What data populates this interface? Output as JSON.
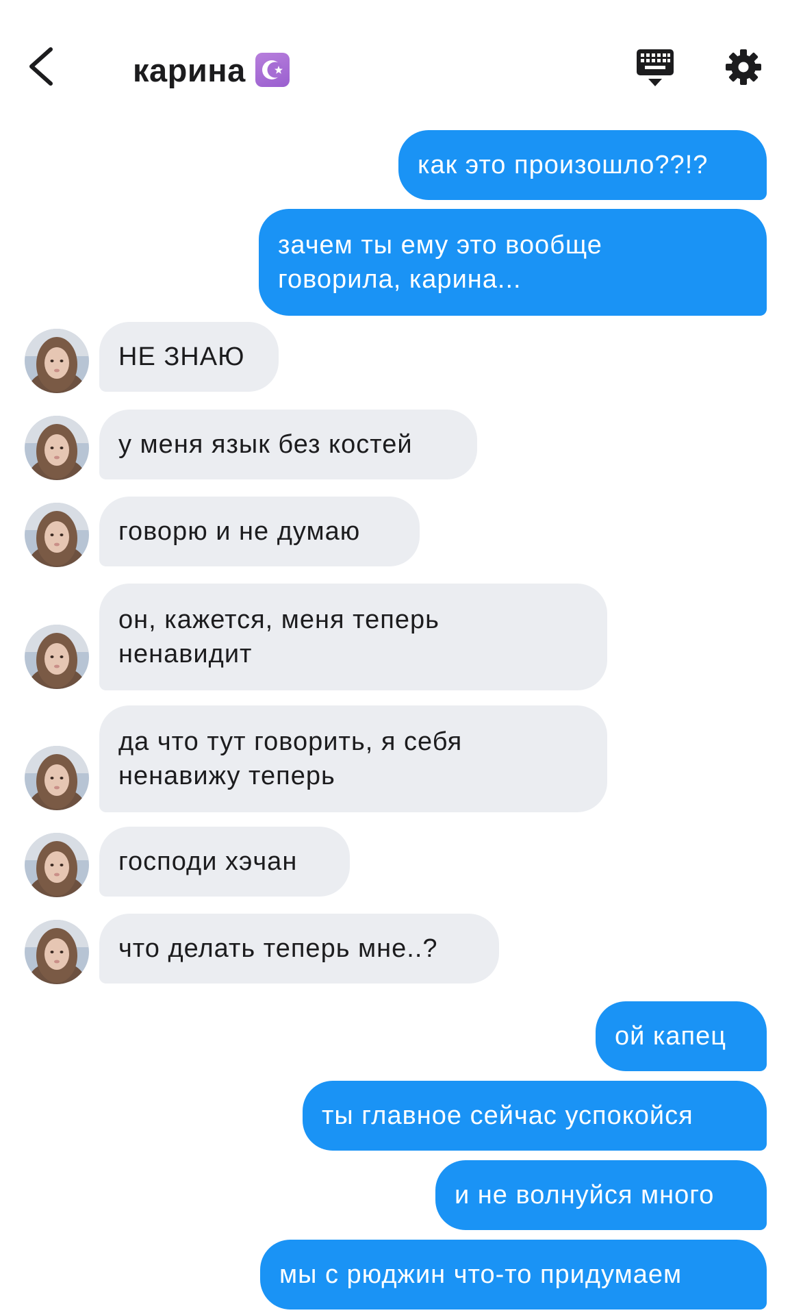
{
  "header": {
    "contact_name": "карина",
    "badge_symbol": "☪",
    "badge_color": "#a66dd4",
    "back_icon": "chevron-left-icon",
    "keyboard_icon": "keyboard-icon",
    "settings_icon": "gear-icon"
  },
  "colors": {
    "outgoing_bubble": "#1a93f5",
    "incoming_bubble": "#ebedf1"
  },
  "messages": [
    {
      "direction": "out",
      "text": "как это произошло??!?"
    },
    {
      "direction": "out",
      "lines": [
        "зачем ты ему это вообще",
        "говорила, карина..."
      ]
    },
    {
      "direction": "in",
      "text": "НЕ ЗНАЮ"
    },
    {
      "direction": "in",
      "text": "у меня язык без костей"
    },
    {
      "direction": "in",
      "text": "говорю и не думаю"
    },
    {
      "direction": "in",
      "lines": [
        "он, кажется, меня теперь",
        "ненавидит"
      ]
    },
    {
      "direction": "in",
      "lines": [
        "да что тут говорить, я себя",
        "ненавижу теперь"
      ]
    },
    {
      "direction": "in",
      "text": "господи хэчан"
    },
    {
      "direction": "in",
      "text": "что делать теперь мне..?"
    },
    {
      "direction": "out",
      "text": "ой капец"
    },
    {
      "direction": "out",
      "text": "ты главное сейчас успокойся"
    },
    {
      "direction": "out",
      "text": "и не волнуйся много"
    },
    {
      "direction": "out",
      "text": "мы с рюджин что-то придумаем"
    }
  ]
}
